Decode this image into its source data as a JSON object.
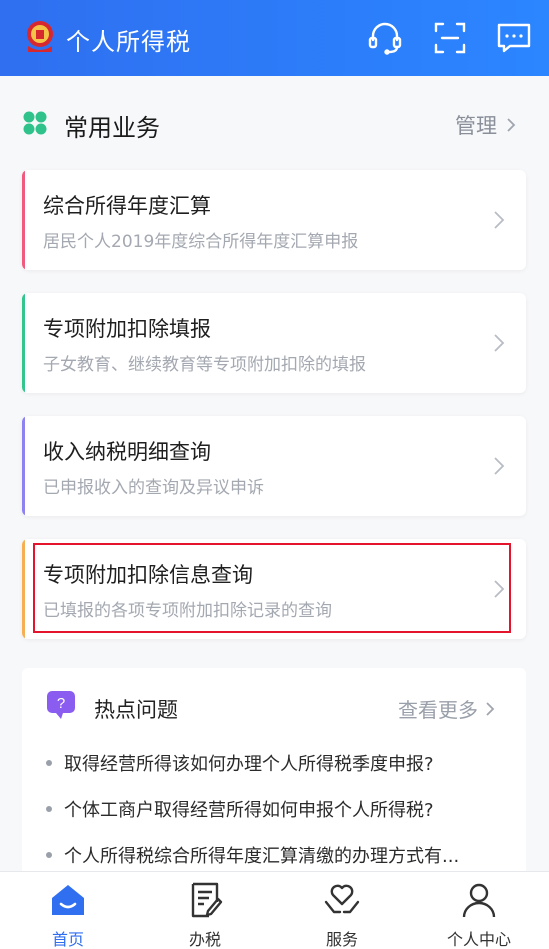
{
  "app": {
    "title": "个人所得税"
  },
  "header": {
    "icons": [
      "customer-service-icon",
      "scan-icon",
      "message-icon"
    ]
  },
  "section": {
    "title": "常用业务",
    "manage_label": "管理"
  },
  "cards": [
    {
      "title": "综合所得年度汇算",
      "subtitle": "居民个人2019年度综合所得年度汇算申报",
      "accent": "#f05a7e"
    },
    {
      "title": "专项附加扣除填报",
      "subtitle": "子女教育、继续教育等专项附加扣除的填报",
      "accent": "#33c58e"
    },
    {
      "title": "收入纳税明细查询",
      "subtitle": "已申报收入的查询及异议申诉",
      "accent": "#8d82f0"
    },
    {
      "title": "专项附加扣除信息查询",
      "subtitle": "已填报的各项专项附加扣除记录的查询",
      "accent": "#f5b054"
    }
  ],
  "hot": {
    "title": "热点问题",
    "more_label": "查看更多",
    "questions": [
      "取得经营所得该如何办理个人所得税季度申报?",
      "个体工商户取得经营所得如何申报个人所得税?",
      "个人所得税综合所得年度汇算清缴的办理方式有..."
    ]
  },
  "tabs": [
    {
      "label": "首页",
      "active": true
    },
    {
      "label": "办税",
      "active": false
    },
    {
      "label": "服务",
      "active": false
    },
    {
      "label": "个人中心",
      "active": false
    }
  ],
  "colors": {
    "brand": "#2f6ff0",
    "highlight": "#e3142b"
  }
}
